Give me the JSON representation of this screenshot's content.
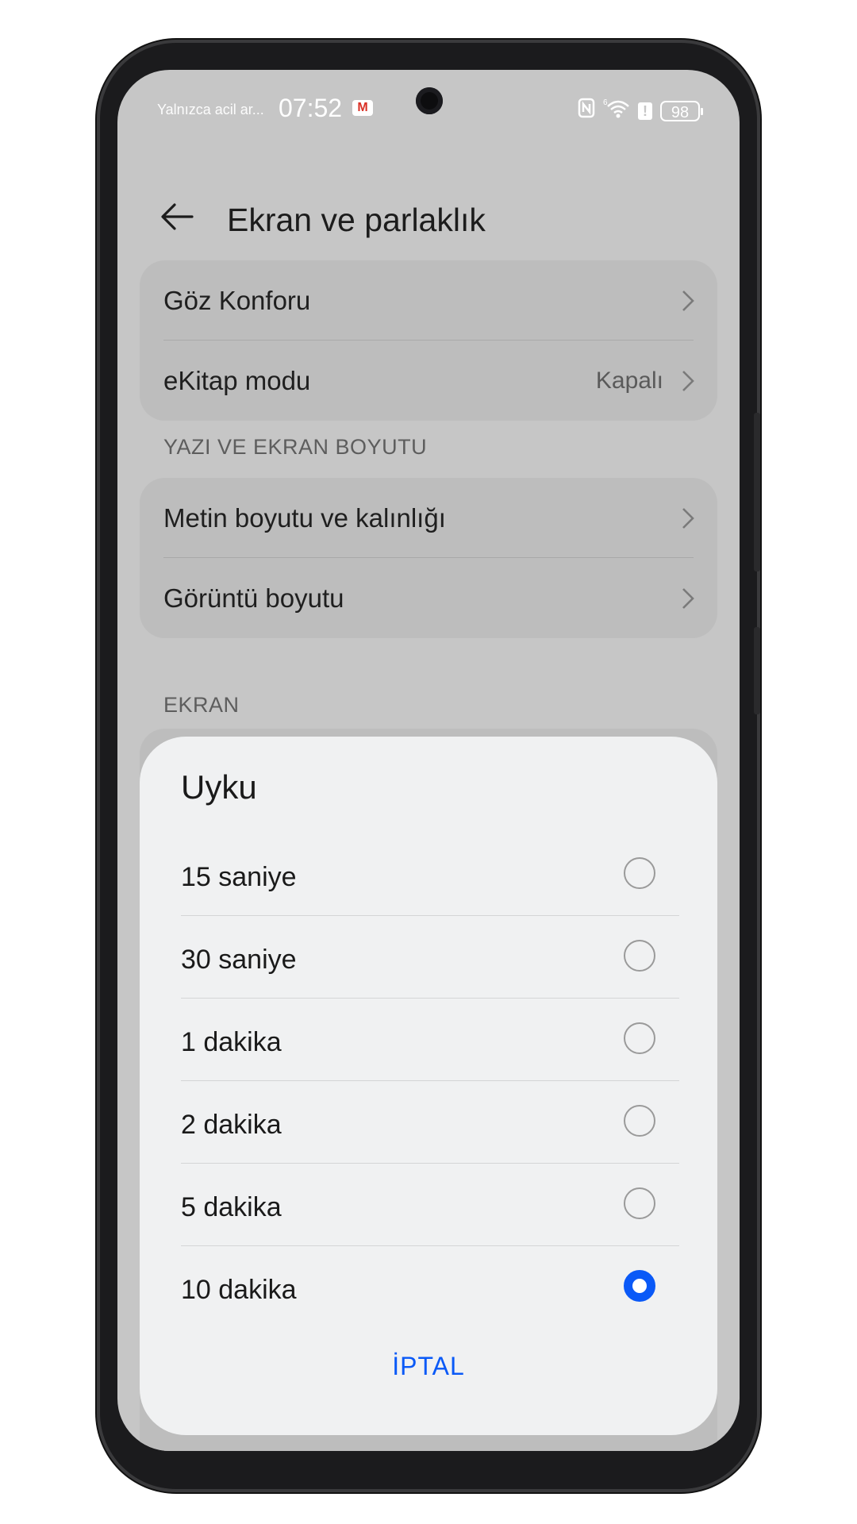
{
  "status_bar": {
    "notification": "Yalnızca acil ar...",
    "time": "07:52",
    "gmail": "M",
    "battery": "98",
    "signal_superscript": "6"
  },
  "header": {
    "title": "Ekran ve parlaklık"
  },
  "card1": {
    "items": [
      {
        "label": "Göz Konforu",
        "value": ""
      },
      {
        "label": "eKitap modu",
        "value": "Kapalı"
      }
    ]
  },
  "sections": {
    "text_display_size": "YAZI VE EKRAN BOYUTU",
    "display": "EKRAN"
  },
  "card2": {
    "items": [
      {
        "label": "Metin boyutu ve kalınlığı"
      },
      {
        "label": "Görüntü boyutu"
      }
    ]
  },
  "dialog": {
    "title": "Uyku",
    "options": [
      {
        "label": "15 saniye",
        "selected": false
      },
      {
        "label": "30 saniye",
        "selected": false
      },
      {
        "label": "1 dakika",
        "selected": false
      },
      {
        "label": "2 dakika",
        "selected": false
      },
      {
        "label": "5 dakika",
        "selected": false
      },
      {
        "label": "10 dakika",
        "selected": true
      }
    ],
    "cancel_label": "İPTAL"
  },
  "colors": {
    "accent": "#0a59f7",
    "scrim": "#c6c6c6",
    "dialog_bg": "#f0f1f2"
  }
}
